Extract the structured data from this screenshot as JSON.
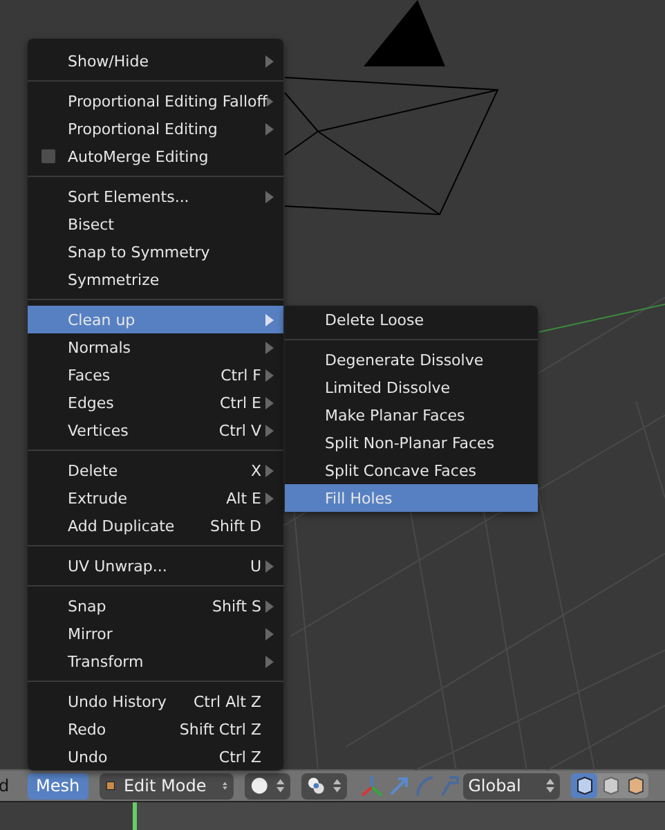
{
  "menu": {
    "sections": [
      {
        "items": [
          {
            "kind": "entry",
            "label": "Show/Hide",
            "submenu": true,
            "selected": false
          }
        ]
      },
      {
        "items": [
          {
            "kind": "entry",
            "label": "Proportional Editing Falloff",
            "submenu": true,
            "selected": false
          },
          {
            "kind": "entry",
            "label": "Proportional Editing",
            "submenu": true,
            "selected": false
          },
          {
            "kind": "checkbox",
            "label": "AutoMerge Editing",
            "checked": false,
            "submenu": false,
            "selected": false
          }
        ]
      },
      {
        "items": [
          {
            "kind": "entry",
            "label": "Sort Elements...",
            "submenu": true,
            "selected": false
          },
          {
            "kind": "entry",
            "label": "Bisect",
            "submenu": false,
            "selected": false
          },
          {
            "kind": "entry",
            "label": "Snap to Symmetry",
            "submenu": false,
            "selected": false
          },
          {
            "kind": "entry",
            "label": "Symmetrize",
            "submenu": false,
            "selected": false
          }
        ]
      },
      {
        "items": [
          {
            "kind": "entry",
            "label": "Clean up",
            "submenu": true,
            "selected": true
          },
          {
            "kind": "entry",
            "label": "Normals",
            "submenu": true,
            "selected": false
          },
          {
            "kind": "entry",
            "label": "Faces",
            "shortcut": "Ctrl F",
            "submenu": true,
            "selected": false
          },
          {
            "kind": "entry",
            "label": "Edges",
            "shortcut": "Ctrl E",
            "submenu": true,
            "selected": false
          },
          {
            "kind": "entry",
            "label": "Vertices",
            "shortcut": "Ctrl V",
            "submenu": true,
            "selected": false
          }
        ]
      },
      {
        "items": [
          {
            "kind": "entry",
            "label": "Delete",
            "shortcut": "X",
            "submenu": true,
            "selected": false
          },
          {
            "kind": "entry",
            "label": "Extrude",
            "shortcut": "Alt E",
            "submenu": true,
            "selected": false
          },
          {
            "kind": "entry",
            "label": "Add Duplicate",
            "shortcut": "Shift D",
            "submenu": false,
            "selected": false
          }
        ]
      },
      {
        "items": [
          {
            "kind": "entry",
            "label": "UV Unwrap...",
            "shortcut": "U",
            "submenu": true,
            "selected": false
          }
        ]
      },
      {
        "items": [
          {
            "kind": "entry",
            "label": "Snap",
            "shortcut": "Shift S",
            "submenu": true,
            "selected": false
          },
          {
            "kind": "entry",
            "label": "Mirror",
            "submenu": true,
            "selected": false
          },
          {
            "kind": "entry",
            "label": "Transform",
            "submenu": true,
            "selected": false
          }
        ]
      },
      {
        "items": [
          {
            "kind": "entry",
            "label": "Undo History",
            "shortcut": "Ctrl Alt Z",
            "submenu": false,
            "selected": false
          },
          {
            "kind": "entry",
            "label": "Redo",
            "shortcut": "Shift Ctrl Z",
            "submenu": false,
            "selected": false
          },
          {
            "kind": "entry",
            "label": "Undo",
            "shortcut": "Ctrl Z",
            "submenu": false,
            "selected": false
          }
        ]
      }
    ]
  },
  "submenu": {
    "sections": [
      {
        "items": [
          {
            "label": "Delete Loose",
            "selected": false
          }
        ]
      },
      {
        "items": [
          {
            "label": "Degenerate Dissolve",
            "selected": false
          },
          {
            "label": "Limited Dissolve",
            "selected": false
          },
          {
            "label": "Make Planar Faces",
            "selected": false
          },
          {
            "label": "Split Non-Planar Faces",
            "selected": false
          },
          {
            "label": "Split Concave Faces",
            "selected": false
          },
          {
            "label": "Fill Holes",
            "selected": true
          }
        ]
      }
    ]
  },
  "header": {
    "cut_label": "d",
    "menu_button": {
      "label": "Mesh",
      "selected": true
    },
    "mode_dropdown": "Edit Mode",
    "orientation_dropdown": "Global"
  }
}
